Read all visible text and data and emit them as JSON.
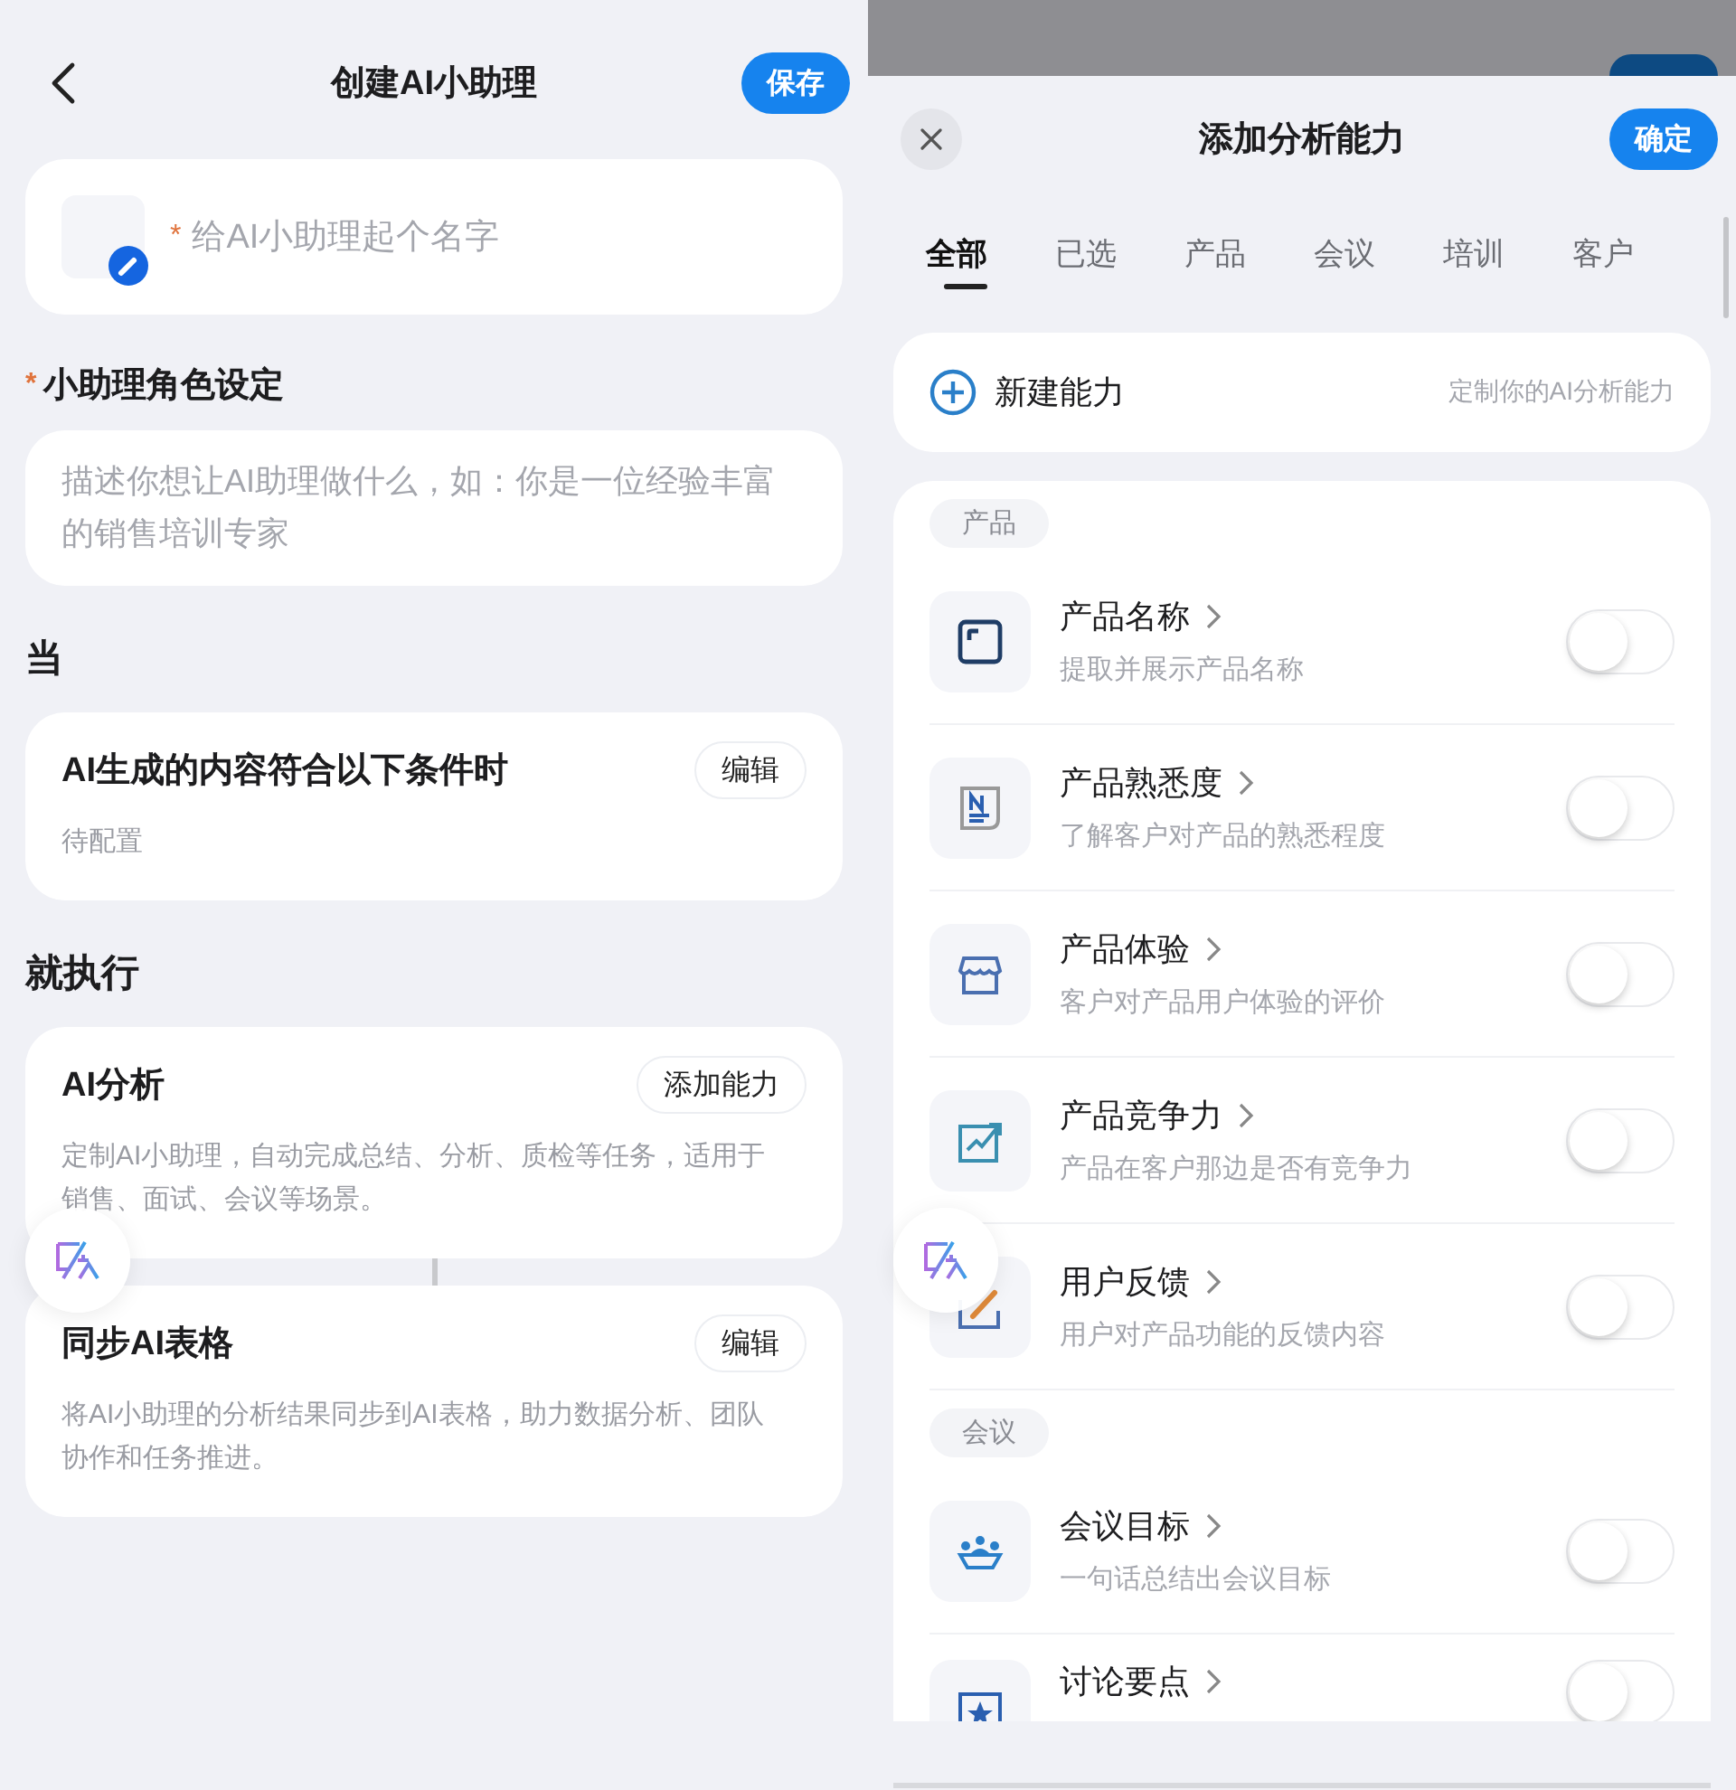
{
  "left_screen": {
    "header": {
      "title": "创建AI小助理",
      "save_button": "保存"
    },
    "name_field": {
      "required_mark": "*",
      "placeholder": "给AI小助理起个名字"
    },
    "role": {
      "required_mark": "*",
      "label": "小助理角色设定",
      "placeholder": "描述你想让AI助理做什么，如：你是一位经验丰富的销售培训专家"
    },
    "when_heading": "当",
    "condition_card": {
      "title": "AI生成的内容符合以下条件时",
      "button": "编辑",
      "status": "待配置"
    },
    "then_heading": "就执行",
    "action_cards": [
      {
        "title": "AI分析",
        "button": "添加能力",
        "description": "定制AI小助理，自动完成总结、分析、质检等任务，适用于销售、面试、会议等场景。"
      },
      {
        "title": "同步AI表格",
        "button": "编辑",
        "description": "将AI小助理的分析结果同步到AI表格，助力数据分析、团队协作和任务推进。"
      }
    ]
  },
  "right_sheet": {
    "title": "添加分析能力",
    "confirm_button": "确定",
    "tabs": [
      {
        "label": "全部",
        "selected": true
      },
      {
        "label": "已选",
        "selected": false
      },
      {
        "label": "产品",
        "selected": false
      },
      {
        "label": "会议",
        "selected": false
      },
      {
        "label": "培训",
        "selected": false
      },
      {
        "label": "客户",
        "selected": false
      }
    ],
    "new_ability": {
      "label": "新建能力",
      "hint": "定制你的AI分析能力"
    },
    "groups": [
      {
        "label": "产品",
        "items": [
          {
            "title": "产品名称",
            "description": "提取并展示产品名称",
            "on": false
          },
          {
            "title": "产品熟悉度",
            "description": "了解客户对产品的熟悉程度",
            "on": false
          },
          {
            "title": "产品体验",
            "description": "客户对产品用户体验的评价",
            "on": false
          },
          {
            "title": "产品竞争力",
            "description": "产品在客户那边是否有竞争力",
            "on": false
          },
          {
            "title": "用户反馈",
            "description": "用户对产品功能的反馈内容",
            "on": false
          }
        ]
      },
      {
        "label": "会议",
        "items": [
          {
            "title": "会议目标",
            "description": "一句话总结出会议目标",
            "on": false
          },
          {
            "title": "讨论要点",
            "on": false
          }
        ]
      }
    ]
  }
}
